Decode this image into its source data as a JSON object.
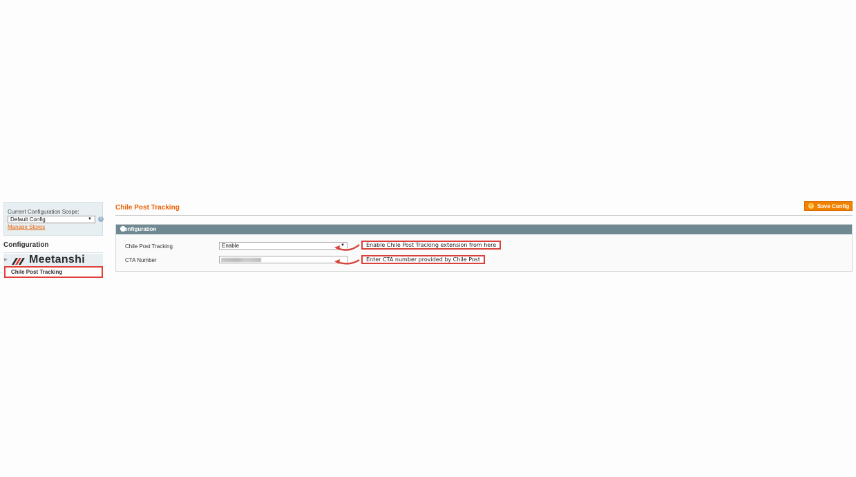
{
  "sidebar": {
    "scope_label": "Current Configuration Scope:",
    "scope_value": "Default Config",
    "manage_stores": "Manage Stores",
    "heading": "Configuration",
    "brand": "Meetanshi",
    "active_item": "Chile Post Tracking"
  },
  "main": {
    "page_title": "Chile Post Tracking",
    "save_button": "Save Config",
    "section_title": "Configuration",
    "fields": [
      {
        "label": "Chile Post Tracking",
        "value": "Enable"
      },
      {
        "label": "CTA Number",
        "value": ""
      }
    ]
  },
  "annotations": {
    "tracking_note": "Enable Chile Post Tracking extension from here",
    "cta_note": "Enter CTA number provided by Chile Post"
  },
  "colors": {
    "accent": "#eb5e00",
    "section_header": "#6f8992",
    "callout_border": "#d9413a"
  }
}
